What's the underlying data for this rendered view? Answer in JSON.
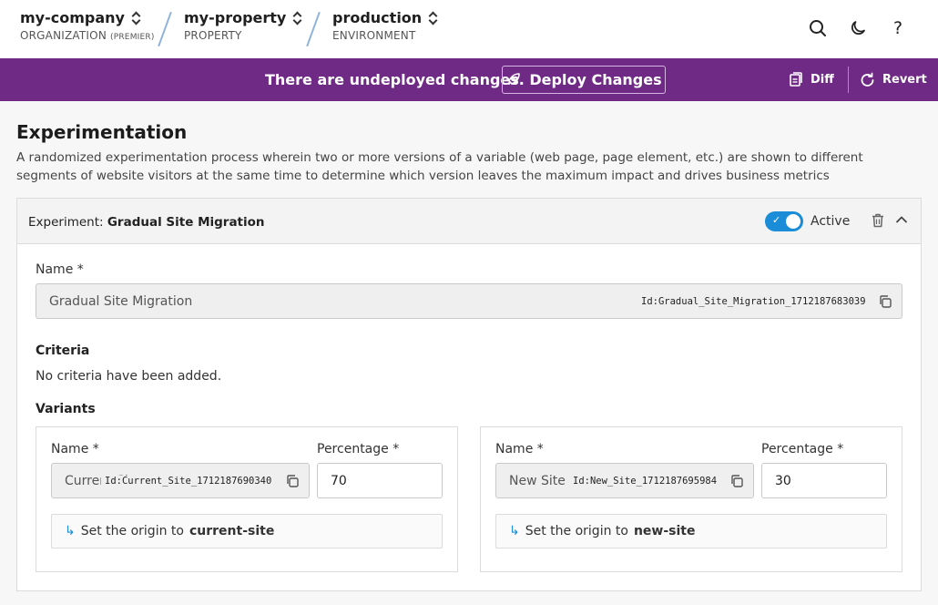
{
  "breadcrumbs": [
    {
      "name": "my-company",
      "sub": "ORGANIZATION",
      "badge": "(PREMIER)"
    },
    {
      "name": "my-property",
      "sub": "PROPERTY"
    },
    {
      "name": "production",
      "sub": "ENVIRONMENT"
    }
  ],
  "icons": {
    "search": "search-icon",
    "theme": "moon-icon",
    "help": "help-icon"
  },
  "banner": {
    "message": "There are undeployed changes.",
    "deploy_label": "Deploy Changes",
    "diff_label": "Diff",
    "revert_label": "Revert",
    "color": "#6e2a84"
  },
  "page": {
    "title": "Experimentation",
    "description": "A randomized experimentation process wherein two or more versions of a variable (web page, page element, etc.) are shown to different segments of website visitors at the same time to determine which version leaves the maximum impact and drives business metrics"
  },
  "experiment": {
    "prefix": "Experiment: ",
    "name": "Gradual Site Migration",
    "active_label": "Active",
    "active": true,
    "name_label": "Name *",
    "name_value": "Gradual Site Migration",
    "id_text": "Id:Gradual_Site_Migration_1712187683039",
    "criteria_label": "Criteria",
    "criteria_empty": "No criteria have been added.",
    "variants_label": "Variants",
    "variants": [
      {
        "name_label": "Name *",
        "name_value": "Current Site",
        "id_text": "Id:Current_Site_1712187690340",
        "pct_label": "Percentage *",
        "pct_value": "70",
        "origin_prefix": "Set the origin to ",
        "origin_value": "current-site"
      },
      {
        "name_label": "Name *",
        "name_value": "New Site",
        "id_text": "Id:New_Site_1712187695984",
        "pct_label": "Percentage *",
        "pct_value": "30",
        "origin_prefix": "Set the origin to ",
        "origin_value": "new-site"
      }
    ]
  },
  "colors": {
    "accent": "#1a8cd8",
    "banner": "#6e2a84"
  }
}
